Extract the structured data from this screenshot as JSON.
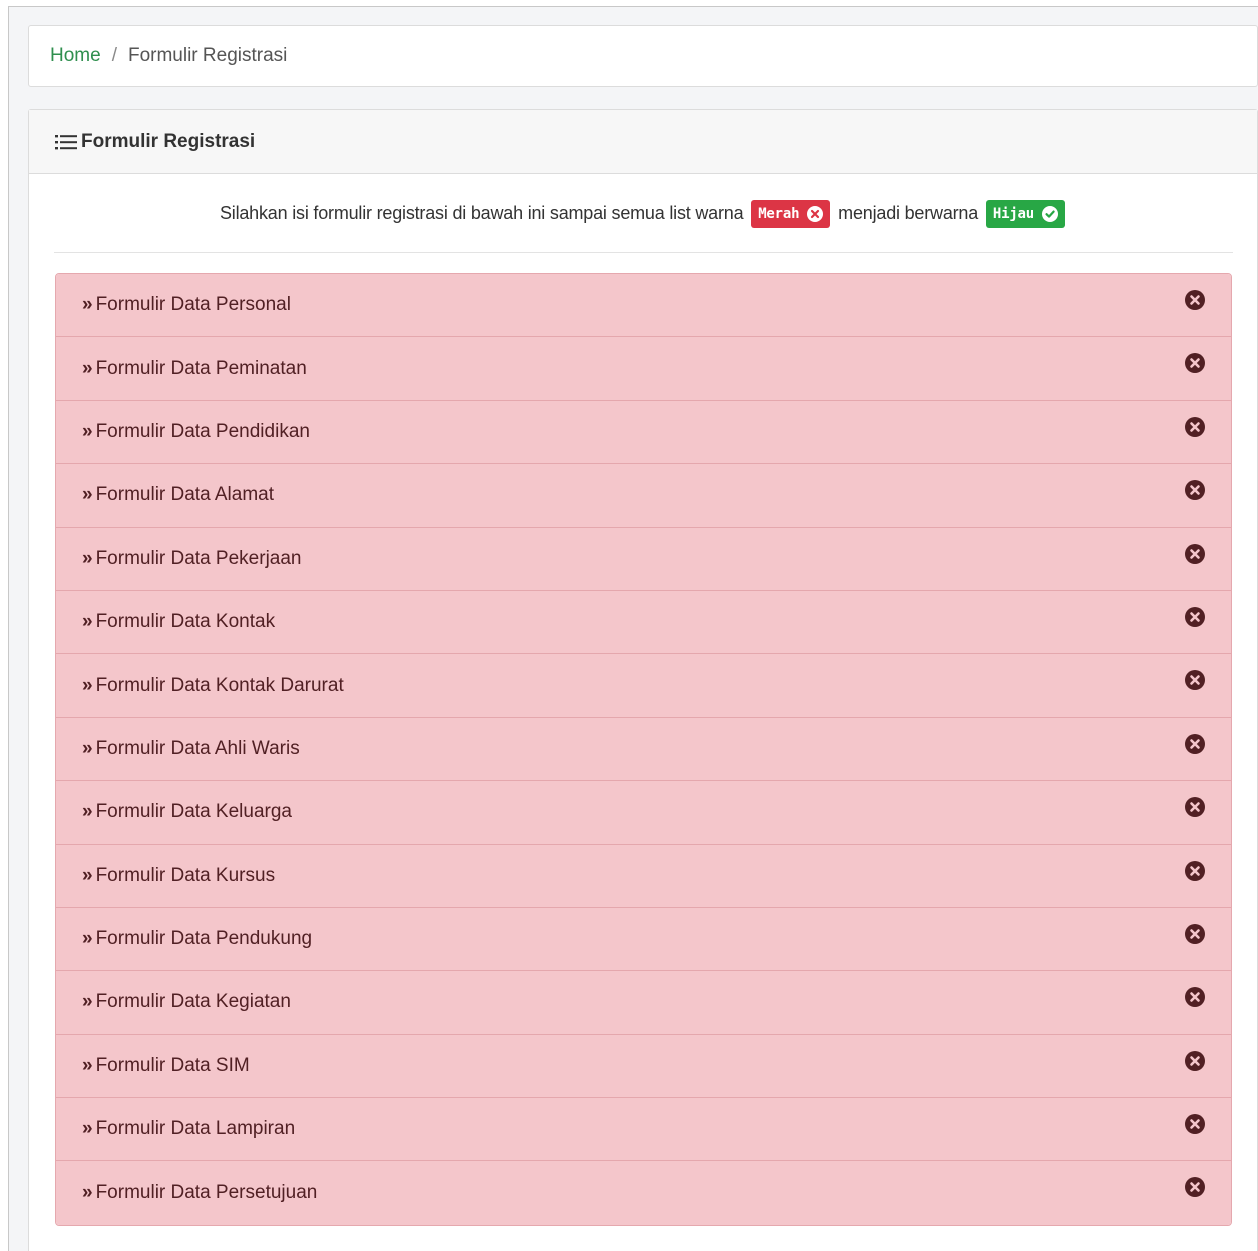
{
  "breadcrumb": {
    "home": "Home",
    "separator": "/",
    "current": "Formulir Registrasi"
  },
  "card": {
    "title": "Formulir Registrasi",
    "icon": "list-icon"
  },
  "instruction": {
    "before": "Silahkan isi formulir registrasi di bawah ini sampai semua list warna",
    "red_badge": "Merah",
    "middle": "menjadi berwarna",
    "green_badge": "Hijau"
  },
  "forms": {
    "chevron": "»",
    "items": [
      {
        "label": "Formulir Data Personal"
      },
      {
        "label": "Formulir Data Peminatan"
      },
      {
        "label": "Formulir Data Pendidikan"
      },
      {
        "label": "Formulir Data Alamat"
      },
      {
        "label": "Formulir Data Pekerjaan"
      },
      {
        "label": "Formulir Data Kontak"
      },
      {
        "label": "Formulir Data Kontak Darurat"
      },
      {
        "label": "Formulir Data Ahli Waris"
      },
      {
        "label": "Formulir Data Keluarga"
      },
      {
        "label": "Formulir Data Kursus"
      },
      {
        "label": "Formulir Data Pendukung"
      },
      {
        "label": "Formulir Data Kegiatan"
      },
      {
        "label": "Formulir Data SIM"
      },
      {
        "label": "Formulir Data Lampiran"
      },
      {
        "label": "Formulir Data Persetujuan"
      }
    ]
  },
  "colors": {
    "link_green": "#2f8f4e",
    "incomplete_bg": "#f4c6cb",
    "badge_red": "#dc3545",
    "badge_green": "#28a745",
    "status_icon": "#512024"
  }
}
